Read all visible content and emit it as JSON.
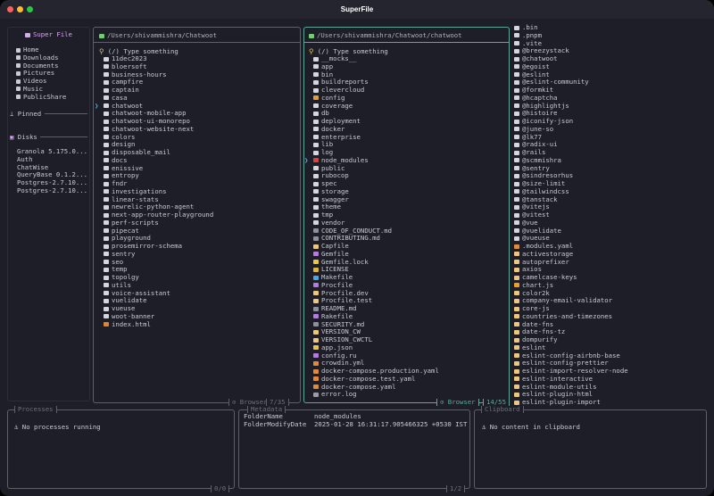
{
  "window": {
    "title": "SuperFile"
  },
  "colors": {
    "bg": "#1d1e27",
    "border": "#5d606b",
    "focus_border": "#5fa898",
    "cursor": "#4fb8e8",
    "brand": "#d9a6f0",
    "path_folder": "#6fce6f"
  },
  "sidebar": {
    "title": "Super File",
    "items": [
      {
        "label": "Home",
        "icon": "home-icon"
      },
      {
        "label": "Downloads",
        "icon": "download-icon"
      },
      {
        "label": "Documents",
        "icon": "document-icon"
      },
      {
        "label": "Pictures",
        "icon": "picture-icon"
      },
      {
        "label": "Videos",
        "icon": "video-icon"
      },
      {
        "label": "Music",
        "icon": "music-icon"
      },
      {
        "label": "PublicShare",
        "icon": "globe-icon"
      }
    ],
    "pinned_label": "Pinned",
    "disks_label": "Disks",
    "disks": [
      "Granola 5.175.0...",
      "Auth",
      "ChatWise",
      "QueryBase 0.1.2...",
      "Postgres-2.7.10...",
      "Postgres-2.7.10..."
    ]
  },
  "panels": [
    {
      "path": "/Users/shivammishra/Chatwoot",
      "search_placeholder": "(/) Type something",
      "mode": "Browser",
      "position": "7/35",
      "cursor": 6,
      "items": [
        [
          "11dec2023",
          "folder"
        ],
        [
          "bloersoft",
          "folder"
        ],
        [
          "business-hours",
          "folder"
        ],
        [
          "campfire",
          "folder"
        ],
        [
          "captain",
          "folder"
        ],
        [
          "casa",
          "folder"
        ],
        [
          "chatwoot",
          "folder"
        ],
        [
          "chatwoot-mobile-app",
          "folder"
        ],
        [
          "chatwoot-ui-monorepo",
          "folder"
        ],
        [
          "chatwoot-website-next",
          "folder"
        ],
        [
          "colors",
          "folder"
        ],
        [
          "design",
          "folder"
        ],
        [
          "disposable_mail",
          "folder"
        ],
        [
          "docs",
          "folder"
        ],
        [
          "enissive",
          "folder"
        ],
        [
          "entropy",
          "folder"
        ],
        [
          "fndr",
          "folder"
        ],
        [
          "investigations",
          "folder"
        ],
        [
          "linear-stats",
          "folder"
        ],
        [
          "newrelic-python-agent",
          "folder"
        ],
        [
          "next-app-router-playground",
          "folder"
        ],
        [
          "perf-scripts",
          "folder"
        ],
        [
          "pipecat",
          "folder"
        ],
        [
          "playground",
          "folder"
        ],
        [
          "prosemirror-schema",
          "folder"
        ],
        [
          "sentry",
          "folder"
        ],
        [
          "seo",
          "folder"
        ],
        [
          "temp",
          "folder"
        ],
        [
          "topolgy",
          "folder"
        ],
        [
          "utils",
          "folder"
        ],
        [
          "voice-assistant",
          "folder"
        ],
        [
          "vuelidate",
          "folder"
        ],
        [
          "vueuse",
          "folder"
        ],
        [
          "woot-banner",
          "folder"
        ],
        [
          "index.html",
          "html"
        ]
      ]
    },
    {
      "path": "/Users/shivammishra/Chatwoot/chatwoot",
      "search_placeholder": "(/) Type something",
      "mode": "Browser",
      "position": "14/55",
      "cursor": 13,
      "items": [
        [
          "__mocks__",
          "folder"
        ],
        [
          "app",
          "folder"
        ],
        [
          "bin",
          "folder"
        ],
        [
          "buildreports",
          "folder"
        ],
        [
          "clevercloud",
          "folder"
        ],
        [
          "config",
          "config"
        ],
        [
          "coverage",
          "folder"
        ],
        [
          "db",
          "folder"
        ],
        [
          "deployment",
          "folder"
        ],
        [
          "docker",
          "folder"
        ],
        [
          "enterprise",
          "folder"
        ],
        [
          "lib",
          "folder"
        ],
        [
          "log",
          "folder"
        ],
        [
          "node_modules",
          "node"
        ],
        [
          "public",
          "folder"
        ],
        [
          "rubocop",
          "folder"
        ],
        [
          "spec",
          "folder"
        ],
        [
          "storage",
          "folder"
        ],
        [
          "swagger",
          "folder"
        ],
        [
          "theme",
          "folder"
        ],
        [
          "tmp",
          "folder"
        ],
        [
          "vendor",
          "folder"
        ],
        [
          "CODE_OF_CONDUCT.md",
          "md"
        ],
        [
          "CONTRIBUTING.md",
          "md"
        ],
        [
          "Capfile",
          "file"
        ],
        [
          "Gemfile",
          "gem"
        ],
        [
          "Gemfile.lock",
          "lock"
        ],
        [
          "LICENSE",
          "key"
        ],
        [
          "Makefile",
          "make"
        ],
        [
          "Procfile",
          "gem"
        ],
        [
          "Procfile.dev",
          "file"
        ],
        [
          "Procfile.test",
          "file"
        ],
        [
          "README.md",
          "md"
        ],
        [
          "Rakefile",
          "gem"
        ],
        [
          "SECURITY.md",
          "md"
        ],
        [
          "VERSION_CW",
          "file"
        ],
        [
          "VERSION_CWCTL",
          "file"
        ],
        [
          "app.json",
          "json"
        ],
        [
          "config.ru",
          "gem"
        ],
        [
          "crowdin.yml",
          "yaml"
        ],
        [
          "docker-compose.production.yaml",
          "yaml"
        ],
        [
          "docker-compose.test.yaml",
          "yaml"
        ],
        [
          "docker-compose.yaml",
          "yaml"
        ],
        [
          "error.log",
          "log"
        ]
      ]
    },
    {
      "items": [
        [
          ".bin",
          "folder"
        ],
        [
          ".pnpm",
          "folder"
        ],
        [
          ".vite",
          "folder"
        ],
        [
          "@breezystack",
          "folder"
        ],
        [
          "@chatwoot",
          "folder"
        ],
        [
          "@egoist",
          "folder"
        ],
        [
          "@eslint",
          "folder"
        ],
        [
          "@eslint-community",
          "folder"
        ],
        [
          "@formkit",
          "folder"
        ],
        [
          "@hcaptcha",
          "folder"
        ],
        [
          "@highlightjs",
          "folder"
        ],
        [
          "@histoire",
          "folder"
        ],
        [
          "@iconify-json",
          "folder"
        ],
        [
          "@june-so",
          "folder"
        ],
        [
          "@lk77",
          "folder"
        ],
        [
          "@radix-ui",
          "folder"
        ],
        [
          "@rails",
          "folder"
        ],
        [
          "@scmmishra",
          "folder"
        ],
        [
          "@sentry",
          "folder"
        ],
        [
          "@sindresorhus",
          "folder"
        ],
        [
          "@size-limit",
          "folder"
        ],
        [
          "@tailwindcss",
          "folder"
        ],
        [
          "@tanstack",
          "folder"
        ],
        [
          "@vitejs",
          "folder"
        ],
        [
          "@vitest",
          "folder"
        ],
        [
          "@vue",
          "folder"
        ],
        [
          "@vuelidate",
          "folder"
        ],
        [
          "@vueuse",
          "folder"
        ],
        [
          ".modules.yaml",
          "yaml"
        ],
        [
          "activestorage",
          "file"
        ],
        [
          "autoprefixer",
          "file"
        ],
        [
          "axios",
          "file"
        ],
        [
          "camelcase-keys",
          "file"
        ],
        [
          "chart.js",
          "js"
        ],
        [
          "color2k",
          "file"
        ],
        [
          "company-email-validator",
          "file"
        ],
        [
          "core-js",
          "file"
        ],
        [
          "countries-and-timezones",
          "file"
        ],
        [
          "date-fns",
          "file"
        ],
        [
          "date-fns-tz",
          "file"
        ],
        [
          "dompurify",
          "file"
        ],
        [
          "eslint",
          "file"
        ],
        [
          "eslint-config-airbnb-base",
          "file"
        ],
        [
          "eslint-config-prettier",
          "file"
        ],
        [
          "eslint-import-resolver-node",
          "file"
        ],
        [
          "eslint-interactive",
          "file"
        ],
        [
          "eslint-module-utils",
          "file"
        ],
        [
          "eslint-plugin-html",
          "file"
        ],
        [
          "eslint-plugin-import",
          "file"
        ]
      ]
    }
  ],
  "processes": {
    "title": "Processes",
    "message": "No processes running",
    "position": "0/0"
  },
  "metadata": {
    "title": "Metadata",
    "rows": [
      [
        "FolderName",
        "node_modules"
      ],
      [
        "FolderModifyDate",
        "2025-01-28 16:31:17.905466325 +0530 IST"
      ]
    ],
    "position": "1/2"
  },
  "clipboard": {
    "title": "Clipboard",
    "message": "No content in clipboard"
  }
}
